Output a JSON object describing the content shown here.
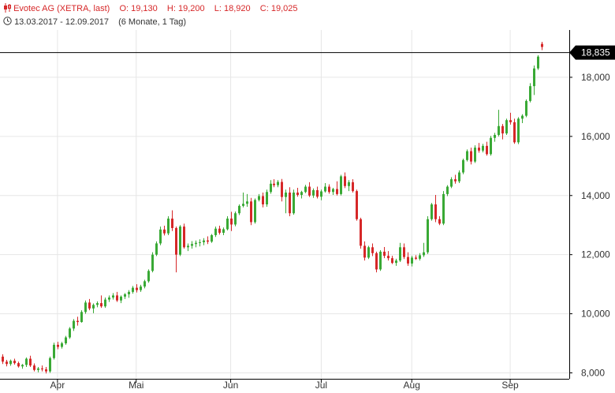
{
  "header": {
    "instrument": "Evotec AG (XETRA, last)",
    "open_label": "O:",
    "open": "19,130",
    "high_label": "H:",
    "high": "19,200",
    "low_label": "L:",
    "low": "18,920",
    "close_label": "C:",
    "close": "19,025",
    "range": "13.03.2017 - 12.09.2017",
    "range_info": "(6 Monate, 1 Tag)"
  },
  "colors": {
    "up": "#39a935",
    "down": "#d62728",
    "grid": "#e6e6e6",
    "axis": "#000000",
    "badge": "#000000"
  },
  "icons": {
    "candle": "candlestick-icon",
    "clock": "clock-icon"
  },
  "chart_data": {
    "type": "candlestick",
    "ylim": [
      7800,
      19600
    ],
    "yticks": [
      "8,000",
      "10,000",
      "12,000",
      "14,000",
      "16,000",
      "18,000"
    ],
    "ytick_values": [
      8000,
      10000,
      12000,
      14000,
      16000,
      18000
    ],
    "x_labels": [
      "Apr",
      "Mai",
      "Jun",
      "Jul",
      "Aug",
      "Sep"
    ],
    "x_label_day_index": [
      14,
      34,
      58,
      81,
      104,
      129
    ],
    "last_value": "18,835",
    "last_value_num": 18835,
    "grid": true,
    "candles": [
      [
        8.55,
        8.63,
        8.3,
        8.38
      ],
      [
        8.38,
        8.44,
        8.22,
        8.3
      ],
      [
        8.3,
        8.45,
        8.24,
        8.41
      ],
      [
        8.41,
        8.48,
        8.28,
        8.33
      ],
      [
        8.33,
        8.38,
        8.18,
        8.22
      ],
      [
        8.22,
        8.3,
        8.14,
        8.27
      ],
      [
        8.27,
        8.52,
        8.2,
        8.48
      ],
      [
        8.48,
        8.58,
        8.2,
        8.25
      ],
      [
        8.25,
        8.32,
        8.05,
        8.1
      ],
      [
        8.1,
        8.2,
        8.02,
        8.15
      ],
      [
        8.15,
        8.25,
        8.05,
        8.12
      ],
      [
        8.12,
        8.2,
        7.98,
        8.05
      ],
      [
        8.05,
        8.55,
        8.0,
        8.5
      ],
      [
        8.5,
        9.02,
        8.45,
        8.95
      ],
      [
        8.95,
        9.05,
        8.8,
        8.88
      ],
      [
        8.88,
        9.05,
        8.82,
        9.0
      ],
      [
        9.0,
        9.25,
        8.95,
        9.2
      ],
      [
        9.2,
        9.55,
        9.15,
        9.5
      ],
      [
        9.5,
        9.82,
        9.42,
        9.76
      ],
      [
        9.76,
        9.9,
        9.6,
        9.72
      ],
      [
        9.72,
        10.12,
        9.7,
        10.06
      ],
      [
        10.06,
        10.45,
        10.0,
        10.38
      ],
      [
        10.38,
        10.5,
        10.12,
        10.18
      ],
      [
        10.18,
        10.35,
        10.02,
        10.3
      ],
      [
        10.3,
        10.42,
        10.22,
        10.36
      ],
      [
        10.36,
        10.62,
        10.2,
        10.25
      ],
      [
        10.25,
        10.55,
        10.2,
        10.48
      ],
      [
        10.48,
        10.62,
        10.4,
        10.55
      ],
      [
        10.55,
        10.7,
        10.48,
        10.62
      ],
      [
        10.62,
        10.74,
        10.4,
        10.45
      ],
      [
        10.45,
        10.62,
        10.36,
        10.58
      ],
      [
        10.58,
        10.7,
        10.5,
        10.66
      ],
      [
        10.66,
        10.8,
        10.54,
        10.74
      ],
      [
        10.74,
        10.94,
        10.68,
        10.88
      ],
      [
        10.88,
        11.0,
        10.72,
        10.8
      ],
      [
        10.8,
        10.98,
        10.74,
        10.92
      ],
      [
        10.92,
        11.15,
        10.86,
        11.1
      ],
      [
        11.1,
        11.5,
        11.05,
        11.45
      ],
      [
        11.45,
        12.08,
        11.4,
        12.0
      ],
      [
        12.0,
        12.45,
        11.95,
        12.38
      ],
      [
        12.38,
        12.95,
        12.32,
        12.85
      ],
      [
        12.85,
        12.98,
        12.65,
        12.72
      ],
      [
        12.72,
        13.3,
        12.66,
        13.22
      ],
      [
        13.22,
        13.5,
        12.8,
        12.9
      ],
      [
        12.9,
        12.95,
        11.4,
        12.0
      ],
      [
        12.0,
        13.0,
        11.95,
        12.95
      ],
      [
        12.95,
        13.05,
        12.2,
        12.25
      ],
      [
        12.25,
        12.38,
        12.12,
        12.3
      ],
      [
        12.3,
        12.46,
        12.2,
        12.36
      ],
      [
        12.36,
        12.48,
        12.25,
        12.4
      ],
      [
        12.4,
        12.52,
        12.28,
        12.42
      ],
      [
        12.42,
        12.56,
        12.32,
        12.48
      ],
      [
        12.48,
        12.62,
        12.36,
        12.44
      ],
      [
        12.44,
        12.7,
        12.4,
        12.66
      ],
      [
        12.66,
        12.95,
        12.6,
        12.88
      ],
      [
        12.88,
        12.98,
        12.68,
        12.74
      ],
      [
        12.74,
        12.92,
        12.66,
        12.86
      ],
      [
        12.86,
        13.3,
        12.82,
        13.22
      ],
      [
        13.22,
        13.45,
        12.8,
        13.02
      ],
      [
        13.02,
        13.46,
        12.96,
        13.4
      ],
      [
        13.4,
        13.7,
        13.34,
        13.65
      ],
      [
        13.65,
        14.1,
        13.6,
        13.72
      ],
      [
        13.72,
        14.05,
        13.62,
        13.8
      ],
      [
        13.8,
        13.92,
        13.0,
        13.1
      ],
      [
        13.1,
        13.9,
        13.05,
        13.85
      ],
      [
        13.85,
        14.05,
        13.8,
        13.98
      ],
      [
        13.98,
        14.1,
        13.6,
        13.7
      ],
      [
        13.7,
        14.2,
        13.62,
        14.12
      ],
      [
        14.12,
        14.52,
        14.06,
        14.4
      ],
      [
        14.4,
        14.55,
        14.28,
        14.35
      ],
      [
        14.35,
        14.52,
        14.28,
        14.46
      ],
      [
        14.46,
        14.56,
        13.8,
        13.95
      ],
      [
        13.95,
        14.2,
        13.4,
        14.1
      ],
      [
        14.1,
        14.28,
        13.3,
        13.4
      ],
      [
        13.4,
        14.2,
        13.35,
        14.1
      ],
      [
        14.1,
        14.26,
        13.96,
        14.02
      ],
      [
        14.02,
        14.16,
        13.9,
        14.12
      ],
      [
        14.12,
        14.36,
        14.08,
        14.3
      ],
      [
        14.3,
        14.45,
        13.95,
        14.0
      ],
      [
        14.0,
        14.24,
        13.92,
        14.18
      ],
      [
        14.18,
        14.3,
        13.9,
        13.96
      ],
      [
        13.96,
        14.2,
        13.84,
        14.14
      ],
      [
        14.14,
        14.42,
        14.1,
        14.3
      ],
      [
        14.3,
        14.38,
        14.06,
        14.12
      ],
      [
        14.12,
        14.26,
        14.02,
        14.22
      ],
      [
        14.22,
        14.48,
        14.0,
        14.05
      ],
      [
        14.05,
        14.7,
        14.0,
        14.65
      ],
      [
        14.65,
        14.78,
        14.25,
        14.32
      ],
      [
        14.32,
        14.52,
        14.15,
        14.45
      ],
      [
        14.45,
        14.55,
        14.1,
        14.15
      ],
      [
        14.15,
        14.2,
        13.15,
        13.2
      ],
      [
        13.2,
        13.25,
        12.2,
        12.3
      ],
      [
        12.3,
        12.45,
        11.8,
        11.9
      ],
      [
        11.9,
        12.3,
        11.85,
        12.25
      ],
      [
        12.25,
        12.38,
        11.95,
        12.05
      ],
      [
        12.05,
        12.1,
        11.4,
        11.5
      ],
      [
        11.5,
        12.15,
        11.45,
        12.1
      ],
      [
        12.1,
        12.26,
        11.88,
        11.96
      ],
      [
        11.96,
        12.12,
        11.8,
        11.88
      ],
      [
        11.88,
        11.96,
        11.68,
        11.72
      ],
      [
        11.72,
        11.86,
        11.62,
        11.8
      ],
      [
        11.8,
        12.4,
        11.75,
        12.25
      ],
      [
        12.25,
        12.38,
        11.85,
        11.92
      ],
      [
        11.92,
        12.08,
        11.62,
        11.7
      ],
      [
        11.7,
        11.96,
        11.6,
        11.9
      ],
      [
        11.9,
        11.98,
        11.82,
        11.86
      ],
      [
        11.86,
        12.05,
        11.8,
        11.98
      ],
      [
        11.98,
        12.4,
        11.92,
        12.08
      ],
      [
        12.08,
        13.3,
        12.02,
        13.2
      ],
      [
        13.2,
        13.75,
        13.15,
        13.7
      ],
      [
        13.7,
        14.02,
        13.1,
        13.2
      ],
      [
        13.2,
        13.3,
        13.0,
        13.05
      ],
      [
        13.05,
        14.15,
        13.0,
        14.05
      ],
      [
        14.05,
        14.35,
        13.98,
        14.3
      ],
      [
        14.3,
        14.62,
        14.25,
        14.55
      ],
      [
        14.55,
        14.7,
        14.4,
        14.48
      ],
      [
        14.48,
        14.85,
        14.42,
        14.78
      ],
      [
        14.78,
        15.25,
        14.72,
        15.2
      ],
      [
        15.2,
        15.56,
        15.15,
        15.5
      ],
      [
        15.5,
        15.62,
        15.05,
        15.15
      ],
      [
        15.15,
        15.7,
        15.1,
        15.62
      ],
      [
        15.62,
        15.78,
        15.45,
        15.52
      ],
      [
        15.52,
        15.75,
        15.46,
        15.68
      ],
      [
        15.68,
        15.82,
        15.35,
        15.4
      ],
      [
        15.4,
        16.02,
        15.35,
        15.95
      ],
      [
        15.95,
        16.12,
        15.82,
        16.05
      ],
      [
        16.05,
        16.9,
        16.0,
        16.35
      ],
      [
        16.35,
        16.42,
        15.9,
        16.1
      ],
      [
        16.1,
        16.6,
        16.05,
        16.55
      ],
      [
        16.55,
        16.8,
        16.4,
        16.48
      ],
      [
        16.48,
        16.6,
        15.75,
        15.8
      ],
      [
        15.8,
        16.65,
        15.74,
        16.6
      ],
      [
        16.6,
        16.75,
        16.45,
        16.7
      ],
      [
        16.7,
        17.25,
        16.65,
        17.2
      ],
      [
        17.2,
        17.8,
        17.15,
        17.7
      ],
      [
        17.7,
        18.4,
        17.4,
        18.3
      ],
      [
        18.3,
        18.75,
        18.25,
        18.7
      ],
      [
        19.13,
        19.2,
        18.92,
        19.025
      ]
    ]
  }
}
